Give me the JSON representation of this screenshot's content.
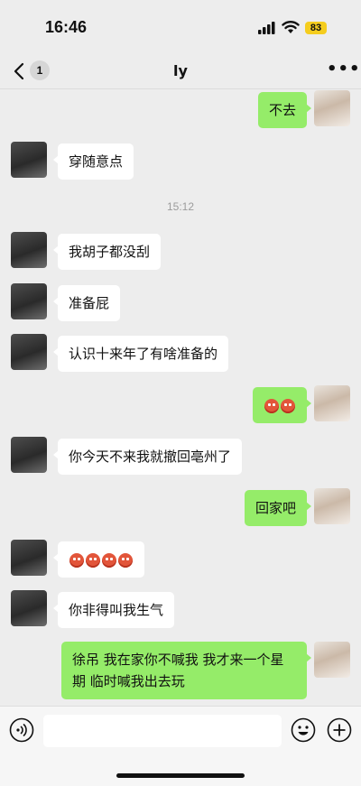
{
  "status_bar": {
    "time": "16:46",
    "battery": "83"
  },
  "nav": {
    "title": "ly",
    "unread_count": "1"
  },
  "messages": [
    {
      "side": "right",
      "text": "不去"
    },
    {
      "side": "left",
      "text": "穿随意点"
    },
    {
      "timestamp": "15:12"
    },
    {
      "side": "left",
      "text": "我胡子都没刮"
    },
    {
      "side": "left",
      "text": "准备屁"
    },
    {
      "side": "left",
      "text": "认识十来年了有啥准备的"
    },
    {
      "side": "right",
      "emoji": [
        "angry-face",
        "angry-face"
      ]
    },
    {
      "side": "left",
      "text": "你今天不来我就撤回亳州了"
    },
    {
      "side": "right",
      "text": "回家吧"
    },
    {
      "side": "left",
      "emoji": [
        "angry-face",
        "angry-face",
        "angry-face",
        "angry-face"
      ]
    },
    {
      "side": "left",
      "text": "你非得叫我生气"
    },
    {
      "side": "right",
      "text": "徐吊 我在家你不喊我 我才来一个星期 临时喊我出去玩"
    }
  ],
  "colors": {
    "self_bubble": "#95ec69",
    "peer_bubble": "#ffffff",
    "background": "#ededed"
  },
  "icons": [
    "back-icon",
    "more-icon",
    "voice-icon",
    "emoji-icon",
    "plus-icon"
  ]
}
